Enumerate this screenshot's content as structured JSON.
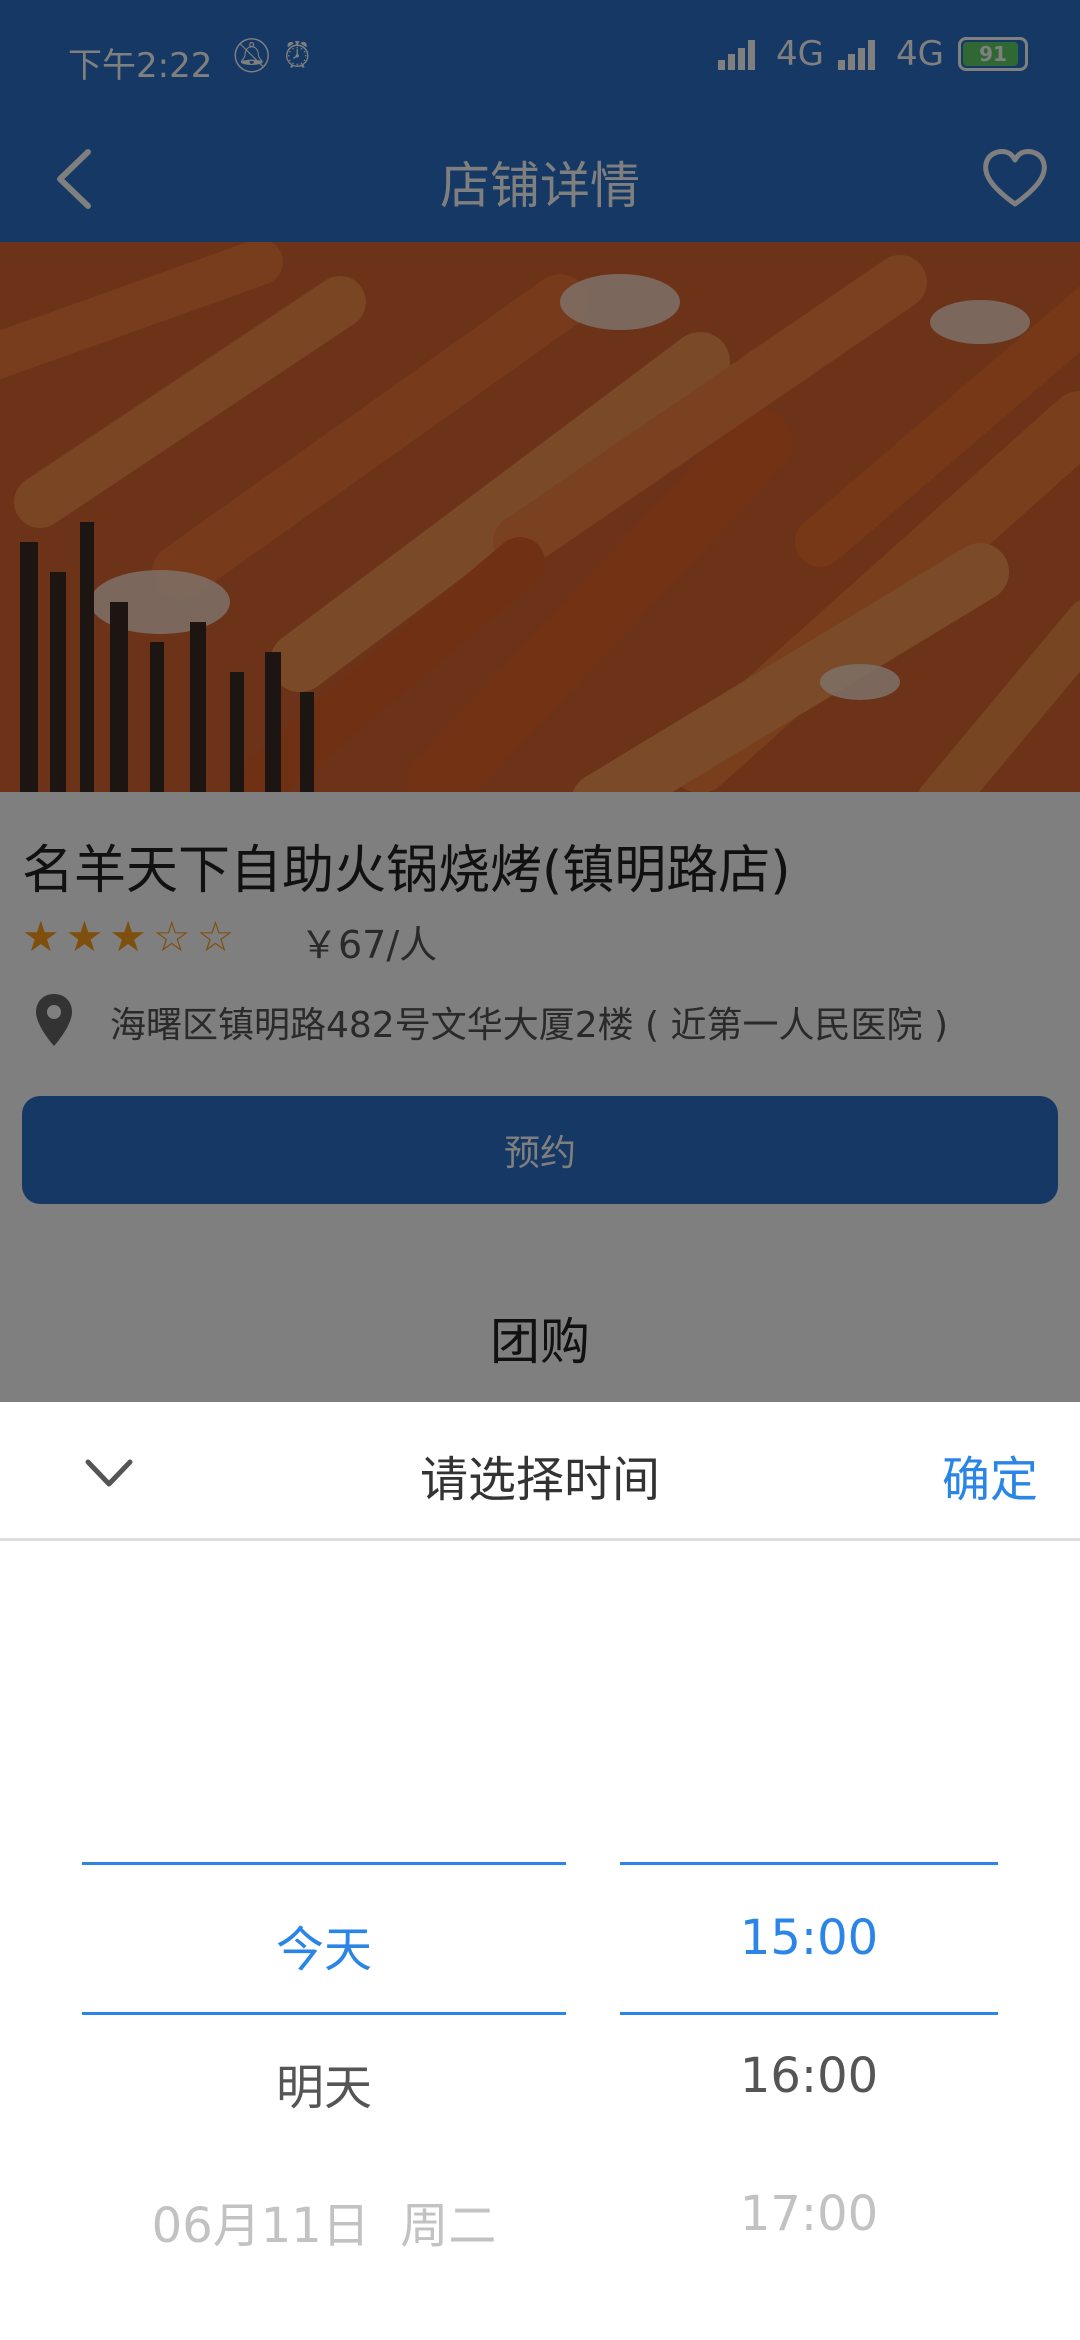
{
  "status_bar": {
    "time": "下午2:22",
    "network_1": "4G",
    "network_2": "4G",
    "battery": "91"
  },
  "navbar": {
    "title": "店铺详情"
  },
  "store": {
    "name": "名羊天下自助火锅烧烤(镇明路店)",
    "rating_stars": 3,
    "rating_max": 5,
    "stars_text": "★★★☆☆",
    "price": "￥67/人",
    "address": "海曙区镇明路482号文华大厦2楼 ( 近第一人民医院 )",
    "book_label": "预约",
    "group_buy_title": "团购"
  },
  "sheet": {
    "title": "请选择时间",
    "confirm_label": "确定",
    "date_options": [
      "今天",
      "明天",
      "06月11日  周二"
    ],
    "time_options": [
      "15:00",
      "16:00",
      "17:00"
    ]
  },
  "colors": {
    "primary": "#2d71c8",
    "accent": "#2a85e6",
    "star": "#ff9f1a"
  }
}
